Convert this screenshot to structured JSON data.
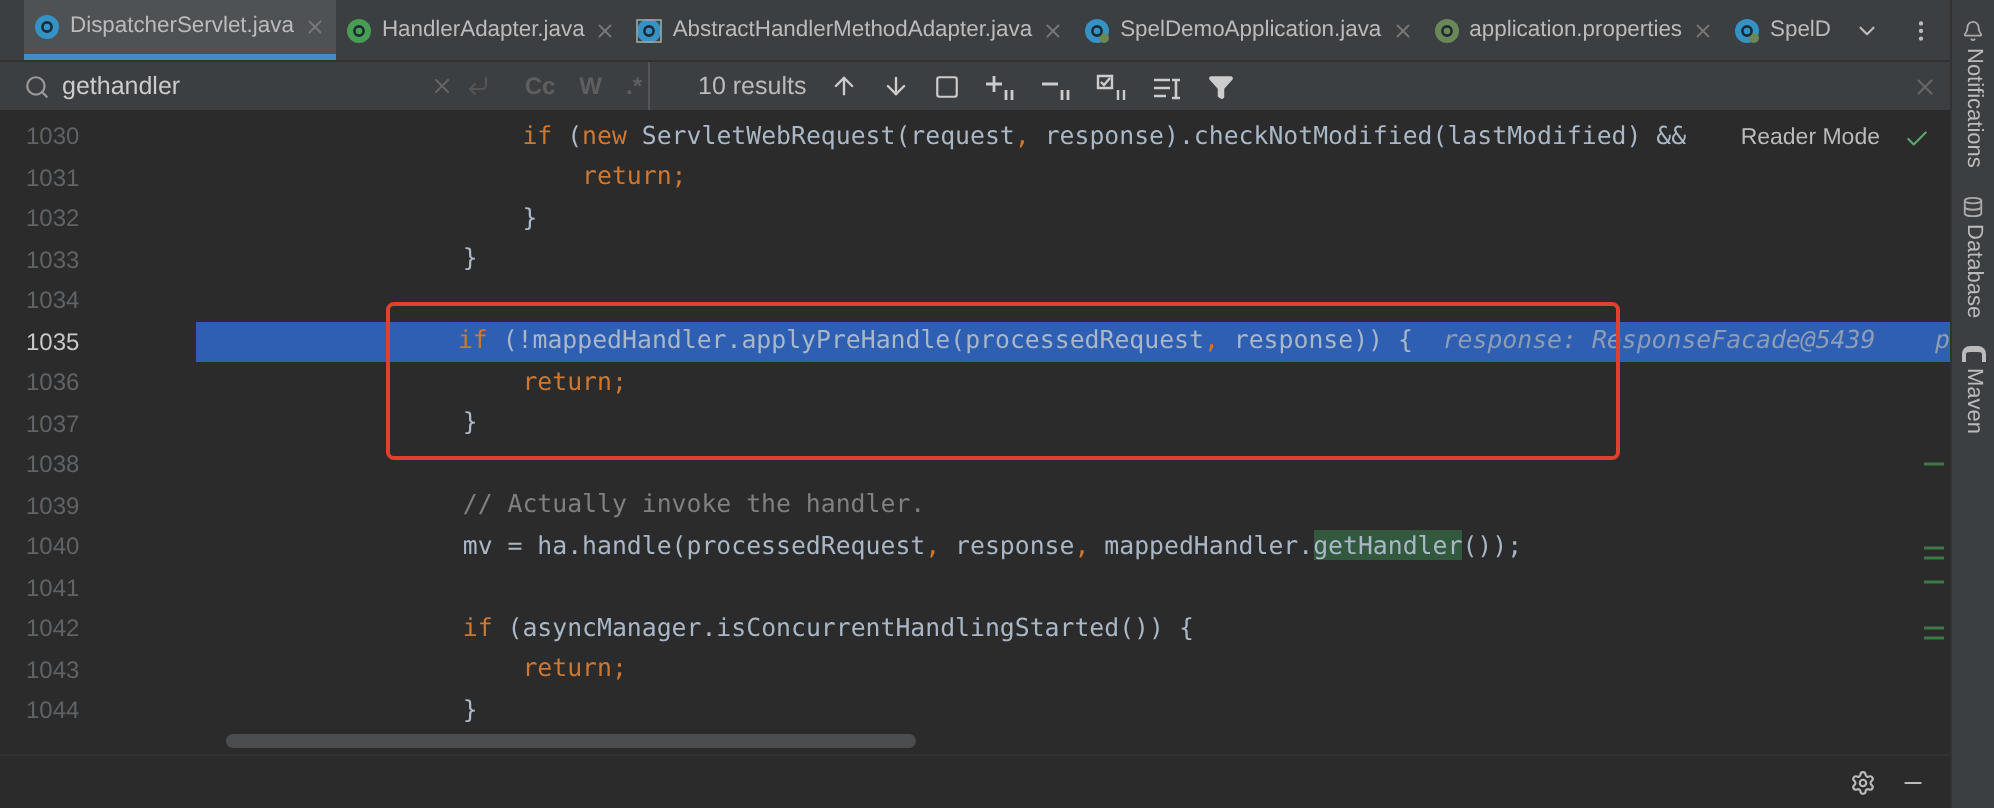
{
  "tabs": [
    {
      "label": "DispatcherServlet.java",
      "kind": "class",
      "selected": true,
      "closable": true
    },
    {
      "label": "HandlerAdapter.java",
      "kind": "interface",
      "selected": false,
      "closable": true
    },
    {
      "label": "AbstractHandlerMethodAdapter.java",
      "kind": "abstract",
      "selected": false,
      "closable": true
    },
    {
      "label": "SpelDemoApplication.java",
      "kind": "spring",
      "selected": false,
      "closable": true
    },
    {
      "label": "application.properties",
      "kind": "properties",
      "selected": false,
      "closable": true
    },
    {
      "label": "SpelD",
      "kind": "spring",
      "selected": false,
      "closable": false
    }
  ],
  "search": {
    "value": "gethandler",
    "options": [
      {
        "label": "Cc",
        "on": false
      },
      {
        "label": "W",
        "on": false
      },
      {
        "label": ".*",
        "on": false
      }
    ],
    "results": "10 results"
  },
  "reader_mode": "Reader Mode",
  "side_tools": [
    {
      "label": "Notifications",
      "kind": "bell"
    },
    {
      "label": "Database",
      "kind": "database"
    },
    {
      "label": "Maven",
      "kind": "maven"
    }
  ],
  "code_blocks": [
    {
      "kind": "plain",
      "lines": [
        {
          "number": "1030",
          "selected": false,
          "segments": [
            {
              "kind": "keyword",
              "text": "                    if "
            },
            {
              "kind": "plain",
              "text": "("
            },
            {
              "kind": "keyword",
              "text": "new "
            },
            {
              "kind": "plain",
              "text": "ServletWebRequest(request"
            },
            {
              "kind": "keyword",
              "text": ", "
            },
            {
              "kind": "plain",
              "text": "response).checkNotModified(lastModified) &&"
            }
          ]
        },
        {
          "number": "1031",
          "selected": false,
          "segments": [
            {
              "kind": "keyword",
              "text": "                        return;"
            }
          ]
        },
        {
          "number": "1032",
          "selected": false,
          "segments": [
            {
              "kind": "plain",
              "text": "                    }"
            }
          ]
        },
        {
          "number": "1033",
          "selected": false,
          "segments": [
            {
              "kind": "plain",
              "text": "                }"
            }
          ]
        },
        {
          "number": "1034",
          "selected": false
        }
      ]
    },
    {
      "kind": "boxed",
      "lines": [
        {
          "number": "1035",
          "selected": true,
          "segments": [
            {
              "kind": "keyword",
              "text": "                if "
            },
            {
              "kind": "plain",
              "text": "(!mappedHandler.applyPreHandle(processedRequest"
            },
            {
              "kind": "keyword",
              "text": ", "
            },
            {
              "kind": "plain",
              "text": "response)) {"
            },
            {
              "kind": "hint",
              "text": "  response: ResponseFacade@5439"
            },
            {
              "kind": "hint",
              "text": "    p"
            }
          ]
        },
        {
          "number": "1036",
          "selected": false,
          "segments": [
            {
              "kind": "keyword",
              "text": "                    return;"
            }
          ]
        },
        {
          "number": "1037",
          "selected": false,
          "segments": [
            {
              "kind": "plain",
              "text": "                }"
            }
          ]
        }
      ]
    },
    {
      "kind": "plain",
      "lines": [
        {
          "number": "1038",
          "selected": false
        },
        {
          "number": "1039",
          "selected": false,
          "segments": [
            {
              "kind": "comment",
              "text": "                // Actually invoke the handler."
            }
          ]
        },
        {
          "number": "1040",
          "selected": false,
          "segments": [
            {
              "kind": "plain",
              "text": "                mv = ha.handle(processedRequest"
            },
            {
              "kind": "keyword",
              "text": ", "
            },
            {
              "kind": "plain",
              "text": "response"
            },
            {
              "kind": "keyword",
              "text": ", "
            },
            {
              "kind": "plain",
              "text": "mappedHandler."
            },
            {
              "kind": "match",
              "text": "getHandler"
            },
            {
              "kind": "plain",
              "text": "());"
            }
          ]
        },
        {
          "number": "1041",
          "selected": false
        },
        {
          "number": "1042",
          "selected": false,
          "segments": [
            {
              "kind": "keyword",
              "text": "                if "
            },
            {
              "kind": "plain",
              "text": "(asyncManager.isConcurrentHandlingStarted()) {"
            }
          ]
        },
        {
          "number": "1043",
          "selected": false,
          "segments": [
            {
              "kind": "keyword",
              "text": "                    return;"
            }
          ]
        },
        {
          "number": "1044",
          "selected": false,
          "segments": [
            {
              "kind": "plain",
              "text": "                }"
            }
          ]
        }
      ]
    }
  ]
}
